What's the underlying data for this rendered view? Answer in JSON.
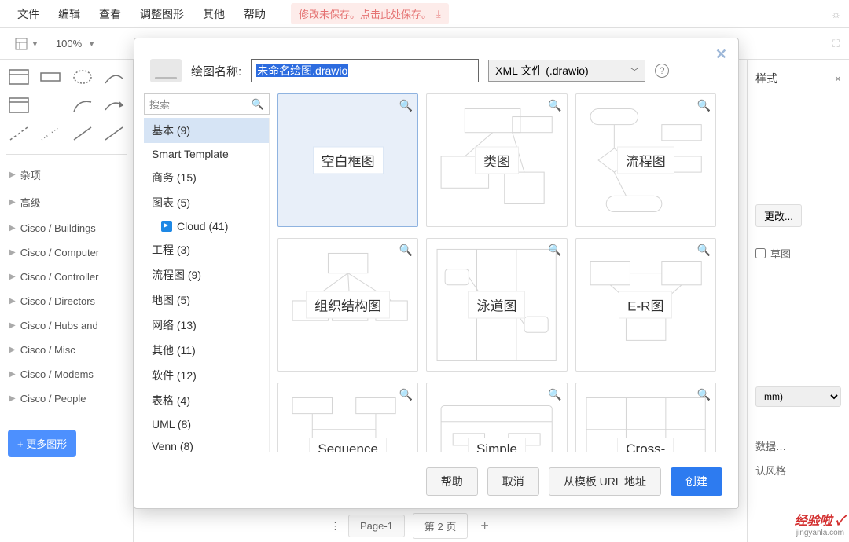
{
  "menubar": {
    "items": [
      "文件",
      "编辑",
      "查看",
      "调整图形",
      "其他",
      "帮助"
    ],
    "save_warning": "修改未保存。点击此处保存。"
  },
  "toolbar": {
    "zoom": "100%"
  },
  "left": {
    "categories": [
      "杂项",
      "高级",
      "Cisco / Buildings",
      "Cisco / Computer",
      "Cisco / Controller",
      "Cisco / Directors",
      "Cisco / Hubs and",
      "Cisco / Misc",
      "Cisco / Modems",
      "Cisco / People"
    ],
    "more_btn": "+ 更多图形"
  },
  "right": {
    "title": "样式",
    "change_btn": "更改...",
    "checkbox_label": "草图",
    "unit": "mm)",
    "edit_data": "数据…",
    "reset_style": "认风格"
  },
  "pages": {
    "tab1": "Page-1",
    "tab2": "第 2 页",
    "menu_dots": "⋮"
  },
  "modal": {
    "file_label": "绘图名称:",
    "file_name_selected": "未命名绘图.drawio",
    "file_type": "XML 文件 (.drawio)",
    "search_placeholder": "搜索",
    "categories": [
      {
        "label": "基本 (9)",
        "selected": true
      },
      {
        "label": "Smart Template"
      },
      {
        "label": "商务 (15)"
      },
      {
        "label": "图表 (5)"
      },
      {
        "label": "Cloud (41)",
        "sub": true,
        "cloud": true
      },
      {
        "label": "工程 (3)"
      },
      {
        "label": "流程图 (9)"
      },
      {
        "label": "地图 (5)"
      },
      {
        "label": "网络 (13)"
      },
      {
        "label": "其他 (11)"
      },
      {
        "label": "软件 (12)"
      },
      {
        "label": "表格 (4)"
      },
      {
        "label": "UML (8)"
      },
      {
        "label": "Venn (8)"
      }
    ],
    "templates": [
      {
        "label": "空白框图",
        "selected": true
      },
      {
        "label": "类图"
      },
      {
        "label": "流程图"
      },
      {
        "label": "组织结构图"
      },
      {
        "label": "泳道图"
      },
      {
        "label": "E-R图"
      },
      {
        "label": "Sequence"
      },
      {
        "label": "Simple"
      },
      {
        "label": "Cross-"
      }
    ],
    "buttons": {
      "help": "帮助",
      "cancel": "取消",
      "from_url": "从模板 URL 地址",
      "create": "创建"
    }
  },
  "watermark": {
    "main": "经验啦 ✓",
    "sub": "jingyanla.com"
  }
}
